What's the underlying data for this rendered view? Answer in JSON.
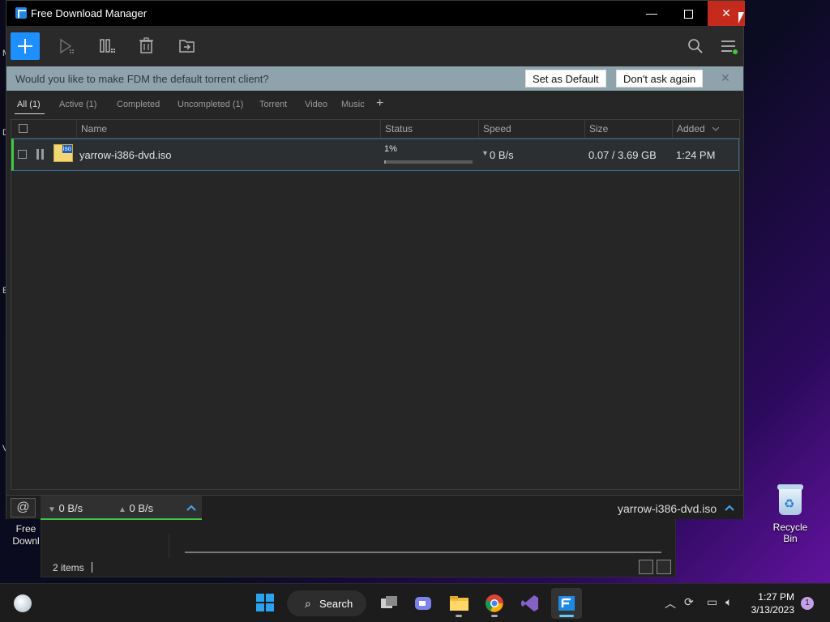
{
  "window": {
    "title": "Free Download Manager",
    "controls": {
      "minimize": "—",
      "maximize": "☐",
      "close": "✕"
    }
  },
  "notice": {
    "question": "Would you like to make FDM the default torrent client?",
    "set_default": "Set as Default",
    "dont_ask": "Don't ask again",
    "close": "✕"
  },
  "filters": [
    "All (1)",
    "Active (1)",
    "Completed",
    "Uncompleted (1)",
    "Torrent",
    "Video",
    "Music"
  ],
  "filter_add": "+",
  "table": {
    "headers": {
      "name": "Name",
      "status": "Status",
      "speed": "Speed",
      "size": "Size",
      "added": "Added"
    },
    "added_sort_icon": "chevron-down-icon",
    "rows": [
      {
        "file_badge": "iso",
        "name": "yarrow-i386-dvd.iso",
        "status_percent": "1%",
        "progress": 0.01,
        "speed": "0 B/s",
        "speed_arrow": "▼",
        "size": "0.07 / 3.69 GB",
        "added": "1:24 PM"
      }
    ]
  },
  "statusbar": {
    "download_speed": "0 B/s",
    "upload_speed": "0 B/s",
    "down_arrow": "▼",
    "up_arrow": "▲",
    "current_file": "yarrow-i386-dvd.iso"
  },
  "background_explorer": {
    "items_count": "2 items",
    "left_labels": [
      "Free",
      "Downl"
    ]
  },
  "desktop": {
    "recycle_bin": "Recycle Bin",
    "edge_letters": [
      "M",
      "D",
      "E",
      "V"
    ]
  },
  "taskbar": {
    "search_label": "Search",
    "time": "1:27 PM",
    "date": "3/13/2023",
    "notification_count": "1"
  },
  "colors": {
    "accent_blue": "#1e8fff",
    "progress_green": "#42c742",
    "close_red": "#c42b1c",
    "notice_bg": "#8fa3ad"
  }
}
